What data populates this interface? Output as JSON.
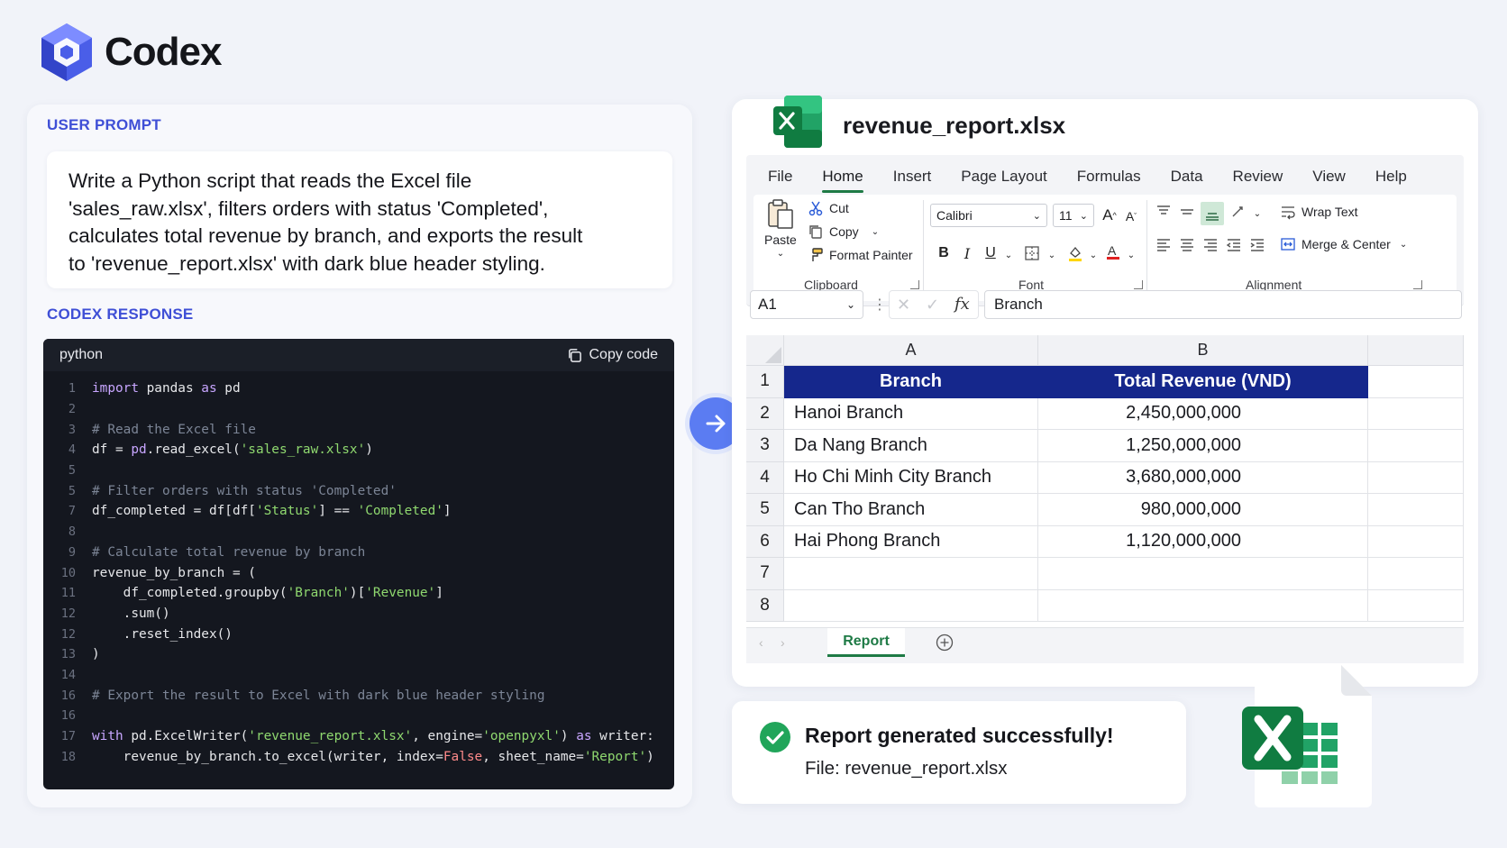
{
  "brand": {
    "name": "Codex"
  },
  "prompt": {
    "label": "USER PROMPT",
    "lines": [
      "Write a Python script that reads the Excel file",
      "'sales_raw.xlsx', filters orders with status 'Completed',",
      "calculates total revenue by branch, and exports the result",
      "to 'revenue_report.xlsx' with dark blue header styling."
    ]
  },
  "response": {
    "label": "CODEX RESPONSE",
    "language": "python",
    "copy_label": "Copy code",
    "lines": [
      {
        "n": "1",
        "parts": [
          [
            "kw",
            "import"
          ],
          [
            "tx",
            " pandas "
          ],
          [
            "kw",
            "as"
          ],
          [
            "tx",
            " pd"
          ]
        ]
      },
      {
        "n": "2",
        "parts": []
      },
      {
        "n": "3",
        "parts": [
          [
            "cm",
            "# Read the Excel file"
          ]
        ]
      },
      {
        "n": "4",
        "parts": [
          [
            "tx",
            "df = "
          ],
          [
            "kw",
            "pd"
          ],
          [
            "tx",
            ".read_excel("
          ],
          [
            "str",
            "'sales_raw.xlsx'"
          ],
          [
            "tx",
            ")"
          ]
        ]
      },
      {
        "n": "5",
        "parts": []
      },
      {
        "n": "5",
        "parts": [
          [
            "cm",
            "# Filter orders with status 'Completed'"
          ]
        ]
      },
      {
        "n": "7",
        "parts": [
          [
            "tx",
            "df_completed = df[df["
          ],
          [
            "str",
            "'Status'"
          ],
          [
            "tx",
            "] == "
          ],
          [
            "str",
            "'Completed'"
          ],
          [
            "tx",
            "]"
          ]
        ]
      },
      {
        "n": "8",
        "parts": []
      },
      {
        "n": "9",
        "parts": [
          [
            "cm",
            "# Calculate total revenue by branch"
          ]
        ]
      },
      {
        "n": "10",
        "parts": [
          [
            "tx",
            "revenue_by_branch = ("
          ]
        ]
      },
      {
        "n": "11",
        "parts": [
          [
            "tx",
            "    df_completed.groupby("
          ],
          [
            "str",
            "'Branch'"
          ],
          [
            "tx",
            ")["
          ],
          [
            "str",
            "'Revenue'"
          ],
          [
            "tx",
            "]"
          ]
        ]
      },
      {
        "n": "12",
        "parts": [
          [
            "tx",
            "    .sum()"
          ]
        ]
      },
      {
        "n": "12",
        "parts": [
          [
            "tx",
            "    .reset_index()"
          ]
        ]
      },
      {
        "n": "13",
        "parts": [
          [
            "tx",
            ")"
          ]
        ]
      },
      {
        "n": "14",
        "parts": []
      },
      {
        "n": "16",
        "parts": [
          [
            "cm",
            "# Export the result to Excel with dark blue header styling"
          ]
        ]
      },
      {
        "n": "16",
        "parts": []
      },
      {
        "n": "17",
        "parts": [
          [
            "kw",
            "with"
          ],
          [
            "tx",
            " pd.ExcelWriter("
          ],
          [
            "str",
            "'revenue_report.xlsx'"
          ],
          [
            "tx",
            ", engine="
          ],
          [
            "str",
            "'openpyxl'"
          ],
          [
            "tx",
            ") "
          ],
          [
            "kw",
            "as"
          ],
          [
            "tx",
            " writer:"
          ]
        ]
      },
      {
        "n": "18",
        "parts": [
          [
            "tx",
            "    revenue_by_branch.to_excel(writer, index="
          ],
          [
            "bool",
            "False"
          ],
          [
            "tx",
            ", sheet_name="
          ],
          [
            "str",
            "'Report'"
          ],
          [
            "tx",
            ")"
          ]
        ]
      }
    ]
  },
  "excel": {
    "filename": "revenue_report.xlsx",
    "tabs": [
      "File",
      "Home",
      "Insert",
      "Page Layout",
      "Formulas",
      "Data",
      "Review",
      "View",
      "Help"
    ],
    "active_tab": "Home",
    "clipboard": {
      "paste": "Paste",
      "cut": "Cut",
      "copy": "Copy",
      "format_painter": "Format Painter",
      "label": "Clipboard"
    },
    "font": {
      "name": "Calibri",
      "size": "11",
      "label": "Font"
    },
    "alignment": {
      "wrap": "Wrap Text",
      "merge": "Merge & Center",
      "label": "Alignment"
    },
    "name_box": "A1",
    "formula": "Branch",
    "fx": "fx",
    "columns": [
      "A",
      "B"
    ],
    "rows": [
      "1",
      "2",
      "3",
      "4",
      "5",
      "6",
      "7",
      "8"
    ],
    "header": [
      "Branch",
      "Total Revenue (VND)"
    ],
    "data": [
      [
        "Hanoi Branch",
        "2,450,000,000"
      ],
      [
        "Da Nang Branch",
        "1,250,000,000"
      ],
      [
        "Ho Chi Minh City Branch",
        "3,680,000,000"
      ],
      [
        "Can Tho Branch",
        "980,000,000"
      ],
      [
        "Hai Phong Branch",
        "1,120,000,000"
      ]
    ],
    "sheet": "Report",
    "header_color": "#15278c",
    "accent_color": "#1e7a45"
  },
  "success": {
    "title": "Report generated successfully!",
    "file": "File: revenue_report.xlsx"
  },
  "colors": {
    "brand": "#3f4fd6",
    "arrow": "#5b7cf2"
  }
}
